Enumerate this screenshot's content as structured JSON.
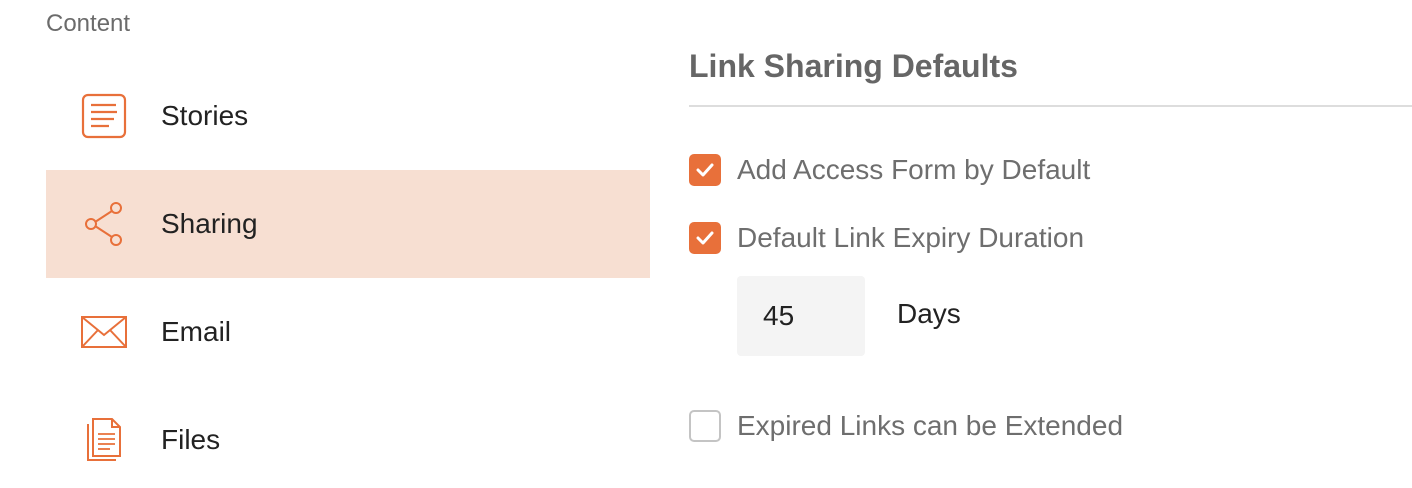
{
  "sidebar": {
    "section_label": "Content",
    "items": [
      {
        "label": "Stories",
        "icon": "document-icon",
        "active": false
      },
      {
        "label": "Sharing",
        "icon": "share-icon",
        "active": true
      },
      {
        "label": "Email",
        "icon": "envelope-icon",
        "active": false
      },
      {
        "label": "Files",
        "icon": "files-icon",
        "active": false
      }
    ]
  },
  "panel": {
    "title": "Link Sharing Defaults",
    "options": [
      {
        "label": "Add Access Form by Default",
        "checked": true
      },
      {
        "label": "Default Link Expiry Duration",
        "checked": true
      },
      {
        "label": "Expired Links can be Extended",
        "checked": false
      }
    ],
    "duration": {
      "value": "45",
      "unit": "Days"
    }
  },
  "colors": {
    "accent": "#e8703a",
    "active_bg": "#f7dfd2",
    "input_bg": "#f4f4f4"
  }
}
